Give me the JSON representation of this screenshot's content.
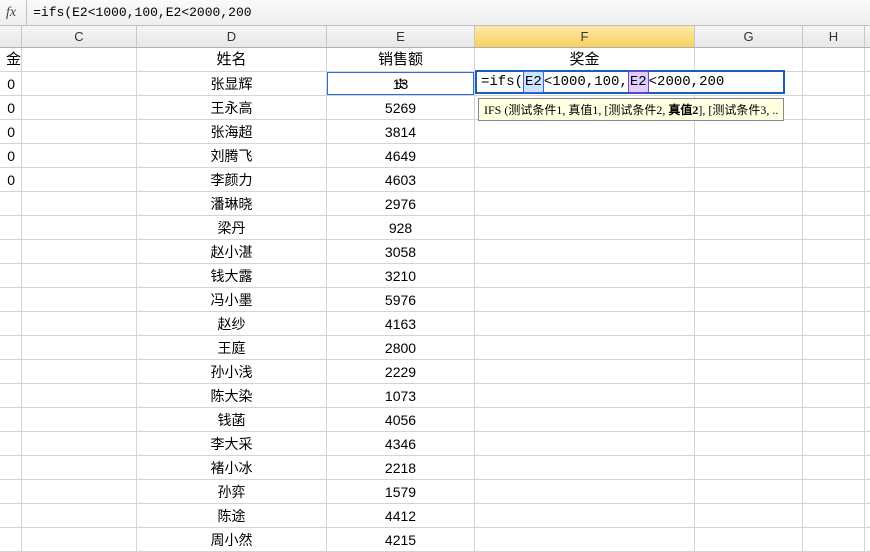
{
  "formula_bar": {
    "fx_label": "fx",
    "value": "=ifs(E2<1000,100,E2<2000,200"
  },
  "columns": {
    "stub": "",
    "c": "C",
    "d": "D",
    "e": "E",
    "f": "F",
    "g": "G",
    "h": "H"
  },
  "header_row": {
    "stub": "金",
    "d": "姓名",
    "e": "销售额",
    "f": "奖金"
  },
  "rows": [
    {
      "stub": "0",
      "name": "张显辉",
      "sales": "13",
      "bonus_formula": "=ifs(E2<1000,100,E2<2000,200"
    },
    {
      "stub": "0",
      "name": "王永高",
      "sales": "5269"
    },
    {
      "stub": "0",
      "name": "张海超",
      "sales": "3814"
    },
    {
      "stub": "0",
      "name": "刘腾飞",
      "sales": "4649"
    },
    {
      "stub": "0",
      "name": "李颜力",
      "sales": "4603"
    },
    {
      "stub": "",
      "name": "潘琳晓",
      "sales": "2976"
    },
    {
      "stub": "",
      "name": "梁丹",
      "sales": "928"
    },
    {
      "stub": "",
      "name": "赵小湛",
      "sales": "3058"
    },
    {
      "stub": "",
      "name": "钱大露",
      "sales": "3210"
    },
    {
      "stub": "",
      "name": "冯小墨",
      "sales": "5976"
    },
    {
      "stub": "",
      "name": "赵纱",
      "sales": "4163"
    },
    {
      "stub": "",
      "name": "王庭",
      "sales": "2800"
    },
    {
      "stub": "",
      "name": "孙小浅",
      "sales": "2229"
    },
    {
      "stub": "",
      "name": "陈大染",
      "sales": "1073"
    },
    {
      "stub": "",
      "name": "钱菡",
      "sales": "4056"
    },
    {
      "stub": "",
      "name": "李大采",
      "sales": "4346"
    },
    {
      "stub": "",
      "name": "褚小冰",
      "sales": "2218"
    },
    {
      "stub": "",
      "name": "孙弈",
      "sales": "1579"
    },
    {
      "stub": "",
      "name": "陈途",
      "sales": "4412"
    },
    {
      "stub": "",
      "name": "周小然",
      "sales": "4215"
    }
  ],
  "overlay_formula": {
    "prefix": "=ifs(",
    "ref1": "E2",
    "mid1": "<1000,100,",
    "ref2": "E2",
    "mid2": "<2000,200"
  },
  "tooltip": {
    "t1": "IFS (测试条件1, 真值1, [测试条件2, ",
    "t2": "真值2",
    "t3": "], [测试条件3, .."
  },
  "cursor_icon": "✢",
  "chart_data": {
    "type": "table",
    "title": "",
    "columns": [
      "姓名",
      "销售额",
      "奖金"
    ],
    "rows": [
      [
        "张显辉",
        13,
        null
      ],
      [
        "王永高",
        5269,
        null
      ],
      [
        "张海超",
        3814,
        null
      ],
      [
        "刘腾飞",
        4649,
        null
      ],
      [
        "李颜力",
        4603,
        null
      ],
      [
        "潘琳晓",
        2976,
        null
      ],
      [
        "梁丹",
        928,
        null
      ],
      [
        "赵小湛",
        3058,
        null
      ],
      [
        "钱大露",
        3210,
        null
      ],
      [
        "冯小墨",
        5976,
        null
      ],
      [
        "赵纱",
        4163,
        null
      ],
      [
        "王庭",
        2800,
        null
      ],
      [
        "孙小浅",
        2229,
        null
      ],
      [
        "陈大染",
        1073,
        null
      ],
      [
        "钱菡",
        4056,
        null
      ],
      [
        "李大采",
        4346,
        null
      ],
      [
        "褚小冰",
        2218,
        null
      ],
      [
        "孙弈",
        1579,
        null
      ],
      [
        "陈途",
        4412,
        null
      ],
      [
        "周小然",
        4215,
        null
      ]
    ]
  }
}
